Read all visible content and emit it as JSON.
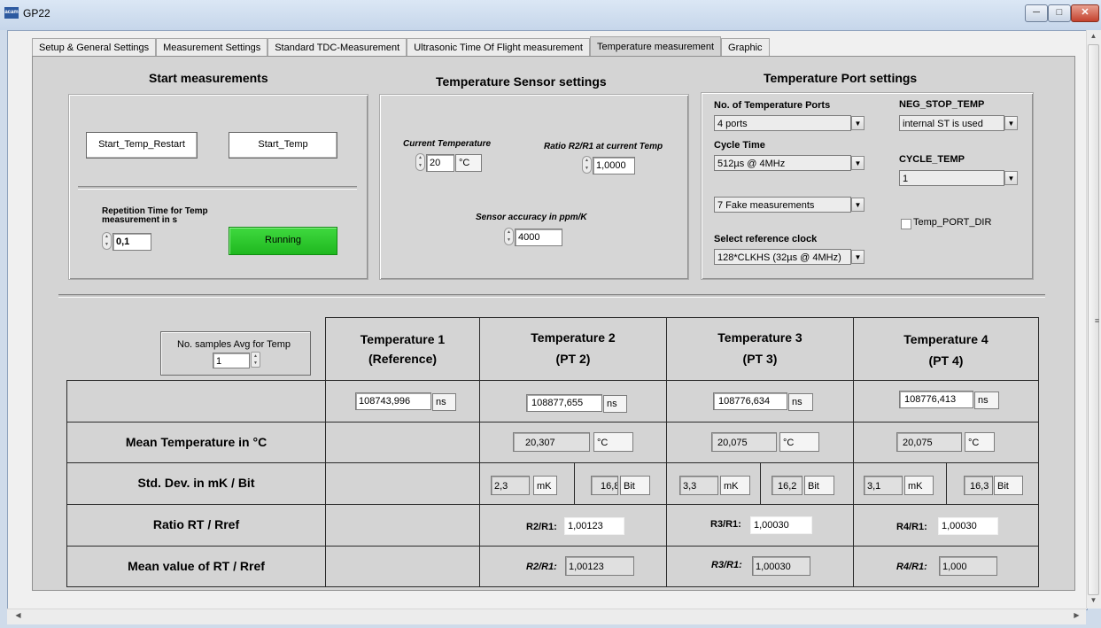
{
  "window": {
    "title": "GP22",
    "app_icon_text": "acam"
  },
  "tabs": [
    "Setup & General Settings",
    "Measurement Settings",
    "Standard TDC-Measurement",
    "Ultrasonic Time Of Flight measurement",
    "Temperature measurement",
    "Graphic"
  ],
  "active_tab": "Temperature measurement",
  "start": {
    "title": "Start measurements",
    "restart_button": "Start_Temp_Restart",
    "start_button": "Start_Temp",
    "repetition_label": "Repetition Time for Temp measurement in s",
    "repetition_value": "0,1",
    "status_led": "Running",
    "led_color": "#2fcc2f"
  },
  "sensor": {
    "title": "Temperature Sensor settings",
    "current_temp_label": "Current Temperature",
    "current_temp_value": "20",
    "current_temp_unit": "°C",
    "ratio_label": "Ratio R2/R1 at current Temp",
    "ratio_value": "1,0000",
    "accuracy_label": "Sensor accuracy  in ppm/K",
    "accuracy_value": "4000"
  },
  "port": {
    "title": "Temperature Port settings",
    "num_ports_label": "No. of Temperature Ports",
    "num_ports_value": "4 ports",
    "cycle_time_label": "Cycle Time",
    "cycle_time_value": "512µs @ 4MHz",
    "fake_value": "7 Fake measurements",
    "ref_clock_label": "Select reference clock",
    "ref_clock_value": "128*CLKHS (32µs @ 4MHz)",
    "neg_stop_label": "NEG_STOP_TEMP",
    "neg_stop_value": "internal ST is used",
    "cycle_temp_label": "CYCLE_TEMP",
    "cycle_temp_value": "1",
    "port_dir_label": "Temp_PORT_DIR"
  },
  "avg": {
    "label": "No. samples Avg for Temp",
    "value": "1"
  },
  "table": {
    "headers": [
      {
        "line1": "Temperature  1",
        "line2": "(Reference)"
      },
      {
        "line1": "Temperature 2",
        "line2": "(PT 2)"
      },
      {
        "line1": "Temperature 3",
        "line2": "(PT 3)"
      },
      {
        "line1": "Temperature 4",
        "line2": "(PT 4)"
      }
    ],
    "row_labels": {
      "mean_temp": "Mean Temperature in °C",
      "std_dev": "Std. Dev. in mK / Bit",
      "ratio": "Ratio RT / Rref",
      "mean_ratio": "Mean value of RT / Rref"
    },
    "times": [
      "108743,996",
      "108877,655",
      "108776,634",
      "108776,413"
    ],
    "time_unit": "ns",
    "mean_temps": [
      "20,307",
      "20,075",
      "20,075"
    ],
    "temp_unit": "°C",
    "std_mk": [
      "2,3",
      "3,3",
      "3,1"
    ],
    "std_bit": [
      "16,8",
      "16,2",
      "16,3"
    ],
    "mk_unit": "mK",
    "bit_unit": "Bit",
    "ratio_labels": [
      "R2/R1:",
      "R3/R1:",
      "R4/R1:"
    ],
    "ratios": [
      "1,00123",
      "1,00030",
      "1,00030"
    ],
    "mean_ratios": [
      "1,00123",
      "1,00030",
      "1,000"
    ]
  }
}
